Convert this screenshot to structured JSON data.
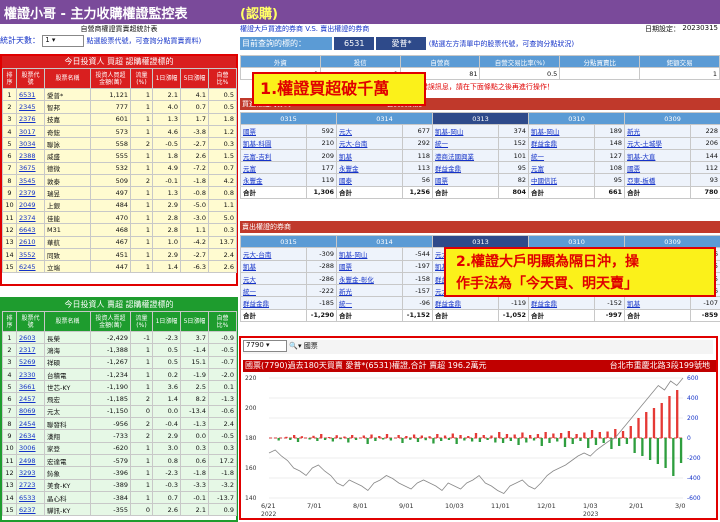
{
  "app": {
    "title": "權證小哥 - 主力收購權證監控表",
    "subtitle": "(認購)"
  },
  "left": {
    "header": "自營商權證買賣超統計表",
    "stat_label": "統計天數：",
    "stat_value": "1",
    "hint": "點選股票代號，可查詢分點買賣資料)",
    "table1": {
      "caption": "今日投資人 買超 認購權證標的",
      "columns": [
        "排序",
        "股票代號",
        "股票名稱",
        "投資人買超金額(萬)",
        "流量(%)",
        "1日漲幅",
        "5日漲幅",
        "自營比%"
      ],
      "rows": [
        [
          "1",
          "6531",
          "愛普*",
          "1,121",
          "1",
          "2.1",
          "4.1",
          "0.5"
        ],
        [
          "2",
          "2345",
          "智邦",
          "777",
          "1",
          "4.0",
          "0.7",
          "0.5"
        ],
        [
          "3",
          "2376",
          "技嘉",
          "601",
          "1",
          "1.3",
          "1.7",
          "1.8"
        ],
        [
          "4",
          "3017",
          "奇鋐",
          "573",
          "1",
          "4.6",
          "-3.8",
          "1.2"
        ],
        [
          "5",
          "3034",
          "聯詠",
          "558",
          "2",
          "-0.5",
          "-2.7",
          "0.3"
        ],
        [
          "6",
          "2388",
          "威盛",
          "555",
          "1",
          "1.8",
          "2.6",
          "1.5"
        ],
        [
          "7",
          "3675",
          "德微",
          "532",
          "1",
          "4.9",
          "-7.2",
          "0.7"
        ],
        [
          "8",
          "3545",
          "敦泰",
          "509",
          "2",
          "-0.1",
          "-1.8",
          "4.2"
        ],
        [
          "9",
          "2379",
          "瑞昱",
          "497",
          "1",
          "1.3",
          "-0.8",
          "0.8"
        ],
        [
          "10",
          "2049",
          "上銀",
          "484",
          "1",
          "2.9",
          "-5.0",
          "1.1"
        ],
        [
          "11",
          "2374",
          "佳能",
          "470",
          "1",
          "2.8",
          "-3.0",
          "5.0"
        ],
        [
          "12",
          "6643",
          "M31",
          "468",
          "1",
          "2.8",
          "1.1",
          "0.3"
        ],
        [
          "13",
          "2610",
          "華航",
          "467",
          "1",
          "1.0",
          "-4.2",
          "13.7"
        ],
        [
          "14",
          "3552",
          "同致",
          "451",
          "1",
          "2.9",
          "-2.7",
          "2.4"
        ],
        [
          "15",
          "6245",
          "立端",
          "447",
          "1",
          "1.4",
          "-6.3",
          "2.6"
        ]
      ]
    },
    "table2": {
      "caption": "今日投資人 賣超 認購權證標的",
      "columns": [
        "排序",
        "股票代號",
        "股票名稱",
        "投資人賣超金額(萬)",
        "流量(%)",
        "1日漲幅",
        "5日漲幅",
        "自營比%"
      ],
      "rows": [
        [
          "1",
          "2603",
          "長榮",
          "-2,429",
          "-1",
          "-2.3",
          "3.7",
          "-0.9"
        ],
        [
          "2",
          "2317",
          "鴻海",
          "-1,388",
          "1",
          "0.5",
          "-1.4",
          "-0.5"
        ],
        [
          "3",
          "5269",
          "祥碩",
          "-1,267",
          "1",
          "0.5",
          "15.1",
          "-0.7"
        ],
        [
          "4",
          "2330",
          "台積電",
          "-1,234",
          "1",
          "0.2",
          "-1.9",
          "-2.0"
        ],
        [
          "5",
          "3661",
          "世芯-KY",
          "-1,190",
          "1",
          "3.6",
          "2.5",
          "0.1"
        ],
        [
          "6",
          "2457",
          "飛宏",
          "-1,185",
          "2",
          "1.4",
          "8.2",
          "-1.3"
        ],
        [
          "7",
          "8069",
          "元太",
          "-1,150",
          "0",
          "0.0",
          "-13.4",
          "-0.6"
        ],
        [
          "8",
          "2454",
          "聯發科",
          "-956",
          "2",
          "-0.4",
          "-1.3",
          "2.4"
        ],
        [
          "9",
          "2634",
          "漢翔",
          "-733",
          "2",
          "2.9",
          "0.0",
          "-0.5"
        ],
        [
          "10",
          "3006",
          "家登",
          "-620",
          "1",
          "3.0",
          "0.3",
          "0.3"
        ],
        [
          "11",
          "2498",
          "宏達電",
          "-579",
          "1",
          "0.8",
          "0.6",
          "17.2"
        ],
        [
          "12",
          "3293",
          "鈊象",
          "-396",
          "1",
          "-2.3",
          "-1.8",
          "-1.8"
        ],
        [
          "13",
          "2723",
          "美食-KY",
          "-389",
          "1",
          "-0.3",
          "-3.3",
          "-3.2"
        ],
        [
          "14",
          "6533",
          "晶心科",
          "-384",
          "1",
          "0.7",
          "-0.1",
          "-13.7"
        ],
        [
          "15",
          "6237",
          "驊訊-KY",
          "-355",
          "0",
          "2.6",
          "2.1",
          "0.9"
        ]
      ]
    }
  },
  "right": {
    "title": "權證大戶買進的券商 V.S. 賣出權證的券商",
    "date_label": "日期設定：",
    "date_value": "20230315",
    "query_label": "目前查詢的標的：",
    "query_code": "6531",
    "query_name": "愛普*",
    "query_hint": "(點選左方清單中的股票代號，可查詢分點狀況)",
    "summary_cols": [
      "外資",
      "投信",
      "自營商",
      "自營交易比率(%)",
      "分點買賣比",
      "鉅額交易"
    ],
    "summary_vals": [
      "0",
      "0",
      "81",
      "0.5",
      "",
      "1"
    ],
    "alert": "※若出現紅字錯誤訊息，請在下面條點之後再進行操作！",
    "buy_title": "買進權證的券商",
    "buy_caption": "180日買賣狀況",
    "dates": [
      "0315",
      "0314",
      "0313",
      "0310",
      "0309"
    ],
    "buy_rows": [
      [
        [
          "國票",
          "592"
        ],
        [
          "元大",
          "677"
        ],
        [
          "凱基-岡山",
          "374"
        ],
        [
          "凱基-岡山",
          "189"
        ],
        [
          "新光",
          "228"
        ]
      ],
      [
        [
          "凱基-科園",
          "210"
        ],
        [
          "元大-台南",
          "292"
        ],
        [
          "統一",
          "152"
        ],
        [
          "群益金鼎",
          "148"
        ],
        [
          "元大-土城學",
          "206"
        ]
      ],
      [
        [
          "元富-吉利",
          "209"
        ],
        [
          "凱基",
          "118"
        ],
        [
          "港商法國興業",
          "101"
        ],
        [
          "統一",
          "127"
        ],
        [
          "凱基-大直",
          "144"
        ]
      ],
      [
        [
          "元富",
          "177"
        ],
        [
          "永豐金",
          "113"
        ],
        [
          "群益金鼎",
          "95"
        ],
        [
          "元富",
          "108"
        ],
        [
          "國票",
          "112"
        ]
      ],
      [
        [
          "永豐金",
          "119"
        ],
        [
          "國泰",
          "56"
        ],
        [
          "國票",
          "82"
        ],
        [
          "中國信託",
          "95"
        ],
        [
          "亞東-板橋",
          "93"
        ]
      ]
    ],
    "buy_totals": [
      "1,306",
      "1,256",
      "804",
      "661",
      "780"
    ],
    "total_label": "合計",
    "sell_title": "賣出權證的券商",
    "sell_rows": [
      [
        [
          "元大-台南",
          "-309"
        ],
        [
          "凱基-岡山",
          "-544"
        ],
        [
          "元大",
          "-484"
        ],
        [
          "國票",
          "-358"
        ],
        [
          "元大",
          "-336"
        ]
      ],
      [
        [
          "凱基",
          "-288"
        ],
        [
          "國票",
          "-197"
        ],
        [
          "凱基-敦南",
          "-181"
        ],
        [
          "凱基-台南",
          "-167"
        ],
        [
          "凱基",
          "-155"
        ]
      ],
      [
        [
          "元大",
          "-286"
        ],
        [
          "永豐金-彰化",
          "-158"
        ],
        [
          "群益金鼎",
          "-138"
        ],
        [
          "元大",
          "-165"
        ],
        [
          "凱基",
          "-135"
        ]
      ],
      [
        [
          "統一",
          "-222"
        ],
        [
          "新光",
          "-157"
        ],
        [
          "元大-台南",
          "-130"
        ],
        [
          "統一",
          "-155"
        ],
        [
          "凱基",
          "-126"
        ]
      ],
      [
        [
          "群益金鼎",
          "-185"
        ],
        [
          "統一",
          "-96"
        ],
        [
          "群益金鼎",
          "-119"
        ],
        [
          "群益金鼎",
          "-152"
        ],
        [
          "凱基",
          "-107"
        ]
      ]
    ],
    "sell_totals": [
      "-1,290",
      "-1,152",
      "-1,052",
      "-997",
      "-859"
    ]
  },
  "chart": {
    "dropdown_value": "7790",
    "search_label": "國票",
    "title": "國票(7790)過去180天買賣 愛普*(6531)權證,合計 賣超 196.2萬元",
    "address": "台北市重慶北路3段199號地",
    "x_labels": [
      "6/21",
      "7/01",
      "8/01",
      "9/01",
      "10/03",
      "11/01",
      "12/01",
      "1/03",
      "2/01",
      "3/0"
    ],
    "x_sub": [
      "2022",
      "",
      "",
      "",
      "",
      "",
      "",
      "2023",
      "",
      ""
    ],
    "right_ticks": [
      "600",
      "400",
      "200",
      "0",
      "-200",
      "-400",
      "-600"
    ],
    "left_ticks": [
      "220",
      "200",
      "180",
      "160",
      "140"
    ]
  },
  "chart_data": {
    "type": "bar",
    "title": "國票(7790)過去180天買賣 愛普*(6531)權證,合計 賣超 196.2萬元",
    "x": [
      "6/21",
      "7/01",
      "8/01",
      "9/01",
      "10/03",
      "11/01",
      "12/01",
      "1/03",
      "2/01",
      "3/0"
    ],
    "bars": [
      0,
      0,
      -25,
      0,
      12,
      -20,
      30,
      -40,
      18,
      0,
      -15,
      22,
      -30,
      40,
      -20,
      10,
      -35,
      28,
      -12,
      15,
      -45,
      30,
      -20,
      0,
      25,
      -60,
      35,
      -30,
      20,
      -15,
      40,
      -25,
      0,
      30,
      -50,
      20,
      -18,
      35,
      -40,
      25,
      -22,
      18,
      -55,
      40,
      -30,
      25,
      -20,
      45,
      -60,
      30,
      -25,
      20,
      -35,
      50,
      -40,
      30,
      -20,
      25,
      -45,
      60,
      -50,
      40,
      -30,
      35,
      -70,
      55,
      -45,
      30,
      -25,
      40,
      -80,
      60,
      -50,
      45,
      -35,
      50,
      -90,
      70,
      -60,
      40,
      -30,
      55,
      -100,
      80,
      -70,
      60,
      -50,
      65,
      -110,
      90,
      -80,
      70,
      -60,
      120,
      -150,
      200,
      -180,
      260,
      -220,
      300,
      -260,
      350,
      -300,
      420,
      -380,
      480,
      -250
    ],
    "price_line": [
      170,
      172,
      168,
      165,
      160,
      158,
      155,
      160,
      162,
      158,
      155,
      150,
      148,
      152,
      150,
      148,
      145,
      150,
      152,
      155,
      153,
      150,
      148,
      146,
      150,
      152,
      150,
      148,
      145,
      150,
      148,
      146,
      150,
      152,
      155,
      150,
      148,
      145,
      143,
      148,
      150,
      152,
      148,
      146,
      150,
      155,
      158,
      160,
      162,
      165,
      168,
      170,
      168,
      172,
      175,
      178,
      180,
      185,
      190,
      195,
      200,
      205,
      210,
      215,
      212,
      218,
      215,
      220
    ],
    "ylim_right": [
      -600,
      600
    ],
    "ylim_left": [
      140,
      220
    ],
    "grid": true
  }
}
